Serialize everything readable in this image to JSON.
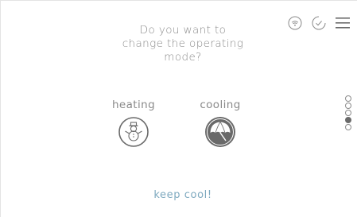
{
  "question": {
    "lines": [
      "Do you want to",
      "change the operating",
      "mode?"
    ]
  },
  "toolbar": {
    "icons": [
      "wifi-icon",
      "check-circle-icon",
      "menu-icon"
    ]
  },
  "modes": [
    {
      "label": "heating",
      "icon": "snowman-icon",
      "selected": false
    },
    {
      "label": "cooling",
      "icon": "umbrella-icon",
      "selected": true
    }
  ],
  "pager": {
    "count": 5,
    "active_index": 3
  },
  "footer": {
    "link_label": "keep cool!"
  },
  "colors": {
    "text": "#8a8a8a",
    "accent": "#7ea9bf",
    "selected_fill": "#6a6a6a"
  }
}
